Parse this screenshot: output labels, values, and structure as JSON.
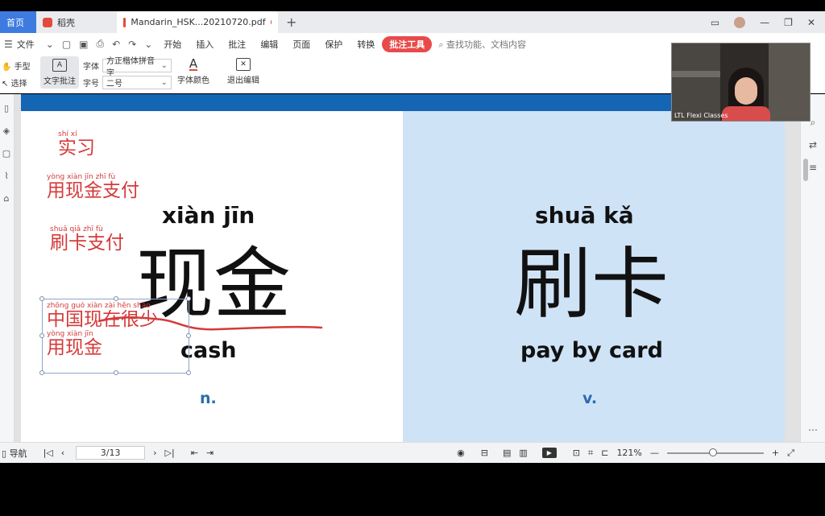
{
  "tabs": {
    "home": "首页",
    "docer": "稻壳",
    "active_file": "Mandarin_HSK...20210720.pdf",
    "new_tab": "+"
  },
  "menu": {
    "file": "文件",
    "items": [
      "开始",
      "插入",
      "批注",
      "编辑",
      "页面",
      "保护",
      "转换"
    ],
    "annotation_tools": "批注工具",
    "search_placeholder": "查找功能、文档内容"
  },
  "toolbar": {
    "hand": "手型",
    "select": "选择",
    "text_annotation": "文字批注",
    "font_label": "字体",
    "font_value": "方正楷体拼音字",
    "size_label": "字号",
    "size_value": "二号",
    "font_color": "字体颜色",
    "exit_edit": "退出编辑"
  },
  "slide": {
    "left": {
      "pinyin": "xiàn   jīn",
      "hanzi": "现金",
      "english": "cash",
      "pos": "n."
    },
    "right": {
      "pinyin": "shuā   kǎ",
      "hanzi": "刷卡",
      "english": "pay by card",
      "pos": "v."
    },
    "notes": [
      {
        "pinyin": "shí    xí",
        "hanzi": "实习"
      },
      {
        "pinyin": "yòng  xiàn   jīn    zhī    fù",
        "hanzi": "用现金支付"
      },
      {
        "pinyin": "shuā   qiǎ    zhī    fù",
        "hanzi": "刷卡支付"
      },
      {
        "pinyin": "zhōng  guó   xiàn   zài   hěn   shǎo",
        "hanzi": "中国现在很少"
      },
      {
        "pinyin": "yòng  xiàn   jīn",
        "hanzi": "用现金"
      }
    ]
  },
  "statusbar": {
    "nav": "导航",
    "page_indicator": "3/13",
    "zoom": "121%"
  },
  "webcam": {
    "label": "LTL Flexi Classes"
  },
  "colors": {
    "accent_blue": "#1565b5",
    "annotation_red": "#d63a3a",
    "right_panel_bg": "#cfe3f7",
    "pos_blue": "#2b6cb0"
  }
}
